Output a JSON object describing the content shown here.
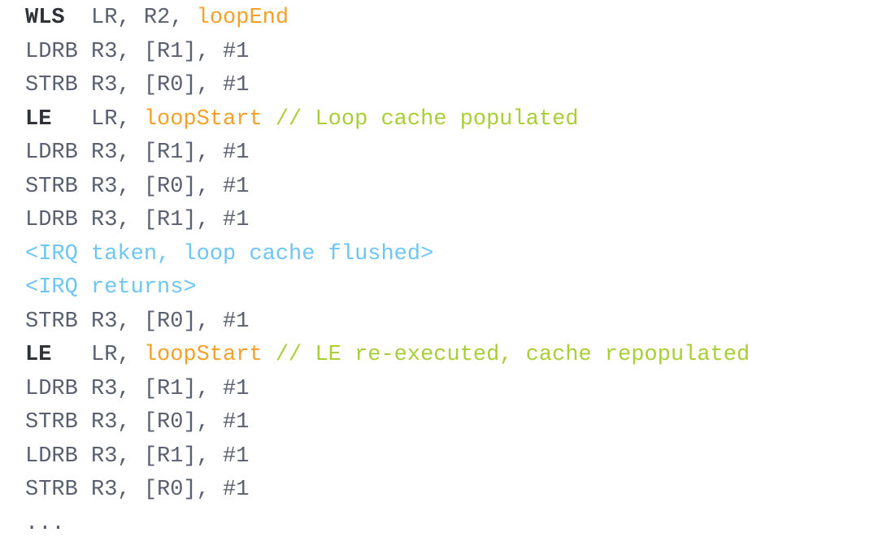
{
  "document": {
    "kind": "assembly-code-listing",
    "background_color": "#ffffff",
    "colors": {
      "plain": "#5a6070",
      "mnemonic": "#2f3338",
      "label": "#f5a028",
      "comment": "#a8ce38",
      "irq": "#6ec6f5"
    },
    "lines": [
      {
        "id": "line-1",
        "name": "instruction-wls",
        "text": "WLS  LR, R2, loopEnd",
        "tokens": [
          {
            "role": "mnemonic",
            "text": "WLS"
          },
          {
            "role": "plain",
            "text": "  LR, R2, "
          },
          {
            "role": "label",
            "text": "loopEnd"
          }
        ]
      },
      {
        "id": "line-2",
        "name": "instruction-ldrb",
        "text": "LDRB R3, [R1], #1",
        "tokens": [
          {
            "role": "plain",
            "text": "LDRB R3, [R1], #1"
          }
        ]
      },
      {
        "id": "line-3",
        "name": "instruction-strb",
        "text": "STRB R3, [R0], #1",
        "tokens": [
          {
            "role": "plain",
            "text": "STRB R3, [R0], #1"
          }
        ]
      },
      {
        "id": "line-4",
        "name": "instruction-le-first",
        "text": "LE   LR, loopStart // Loop cache populated",
        "tokens": [
          {
            "role": "mnemonic",
            "text": "LE"
          },
          {
            "role": "plain",
            "text": "   LR, "
          },
          {
            "role": "label",
            "text": "loopStart"
          },
          {
            "role": "plain",
            "text": " "
          },
          {
            "role": "comment",
            "text": "// Loop cache populated"
          }
        ]
      },
      {
        "id": "line-5",
        "name": "instruction-ldrb",
        "text": "LDRB R3, [R1], #1",
        "tokens": [
          {
            "role": "plain",
            "text": "LDRB R3, [R1], #1"
          }
        ]
      },
      {
        "id": "line-6",
        "name": "instruction-strb",
        "text": "STRB R3, [R0], #1",
        "tokens": [
          {
            "role": "plain",
            "text": "STRB R3, [R0], #1"
          }
        ]
      },
      {
        "id": "line-7",
        "name": "instruction-ldrb",
        "text": "LDRB R3, [R1], #1",
        "tokens": [
          {
            "role": "plain",
            "text": "LDRB R3, [R1], #1"
          }
        ]
      },
      {
        "id": "line-8",
        "name": "annotation-irq-taken",
        "text": "<IRQ taken, loop cache flushed>",
        "tokens": [
          {
            "role": "irq",
            "text": "<IRQ taken, loop cache flushed>"
          }
        ]
      },
      {
        "id": "line-9",
        "name": "annotation-irq-returns",
        "text": "<IRQ returns>",
        "tokens": [
          {
            "role": "irq",
            "text": "<IRQ returns>"
          }
        ]
      },
      {
        "id": "line-10",
        "name": "instruction-strb",
        "text": "STRB R3, [R0], #1",
        "tokens": [
          {
            "role": "plain",
            "text": "STRB R3, [R0], #1"
          }
        ]
      },
      {
        "id": "line-11",
        "name": "instruction-le-second",
        "text": "LE   LR, loopStart // LE re-executed, cache repopulated",
        "tokens": [
          {
            "role": "mnemonic",
            "text": "LE"
          },
          {
            "role": "plain",
            "text": "   LR, "
          },
          {
            "role": "label",
            "text": "loopStart"
          },
          {
            "role": "plain",
            "text": " "
          },
          {
            "role": "comment",
            "text": "// LE re-executed, cache repopulated"
          }
        ]
      },
      {
        "id": "line-12",
        "name": "instruction-ldrb",
        "text": "LDRB R3, [R1], #1",
        "tokens": [
          {
            "role": "plain",
            "text": "LDRB R3, [R1], #1"
          }
        ]
      },
      {
        "id": "line-13",
        "name": "instruction-strb",
        "text": "STRB R3, [R0], #1",
        "tokens": [
          {
            "role": "plain",
            "text": "STRB R3, [R0], #1"
          }
        ]
      },
      {
        "id": "line-14",
        "name": "instruction-ldrb",
        "text": "LDRB R3, [R1], #1",
        "tokens": [
          {
            "role": "plain",
            "text": "LDRB R3, [R1], #1"
          }
        ]
      },
      {
        "id": "line-15",
        "name": "instruction-strb",
        "text": "STRB R3, [R0], #1",
        "tokens": [
          {
            "role": "plain",
            "text": "STRB R3, [R0], #1"
          }
        ]
      },
      {
        "id": "line-16",
        "name": "continuation-ellipsis",
        "text": "...",
        "tokens": [
          {
            "role": "ellipsis",
            "text": "..."
          }
        ]
      }
    ]
  }
}
